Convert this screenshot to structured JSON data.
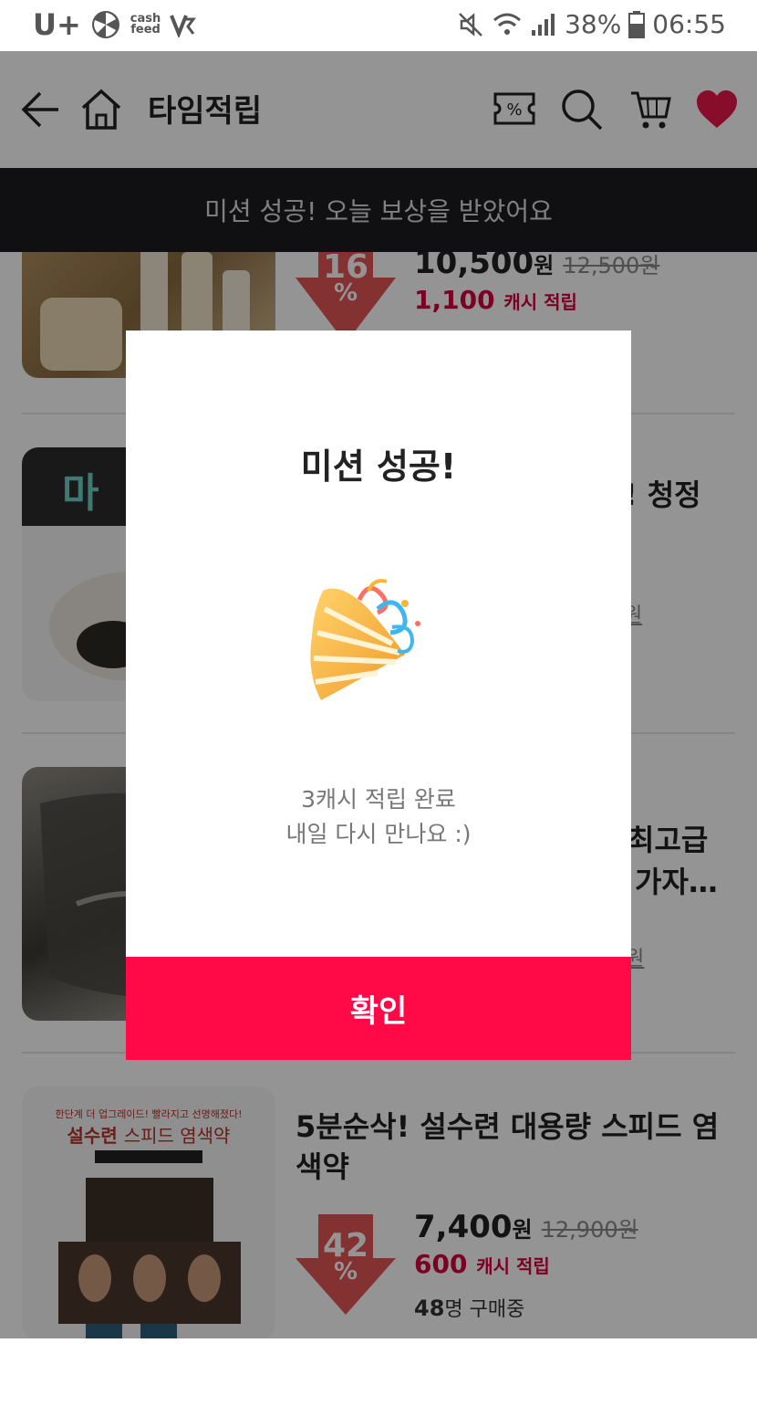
{
  "status_bar": {
    "carrier": "U+",
    "app_label_top": "cash",
    "app_label_bottom": "feed",
    "battery": "38%",
    "time": "06:55"
  },
  "app_bar": {
    "title": "타임적립",
    "icons": [
      "back-arrow-icon",
      "home-icon",
      "coupon-icon",
      "search-icon",
      "cart-icon",
      "heart-icon"
    ]
  },
  "banner": {
    "text": "미션 성공! 오늘 보상을 받았어요"
  },
  "products": [
    {
      "discount": "16",
      "price": "10,500",
      "price_unit": "원",
      "original_price": "12,500원",
      "cash": "1,100",
      "cash_label": "캐시 적립"
    },
    {
      "thumb_label": "마",
      "title_fragment": "! 청정",
      "original_fragment": "원"
    },
    {
      "title_fragment_1": "최고급",
      "title_fragment_2": "가자…",
      "original_fragment": "원"
    },
    {
      "title": "5분순삭! 설수련 대용량 스피드 염색약",
      "thumb_text_1": "한단계 더 업그레이드! 빨라지고 선명해졌다!",
      "thumb_text_2": "설수련",
      "thumb_text_3": "스피드 염색약",
      "discount": "42",
      "price": "7,400",
      "price_unit": "원",
      "original_price": "12,900원",
      "cash": "600",
      "cash_label": "캐시 적립",
      "buyers_count": "48",
      "buyers_label": "명 구매중"
    }
  ],
  "modal": {
    "title": "미션 성공!",
    "message_line1": "3캐시 적립 완료",
    "message_line2": "내일 다시 만나요 :)",
    "confirm_label": "확인"
  },
  "colors": {
    "accent": "#ff0a47",
    "cash_red": "#d6003f",
    "banner_bg": "#1c1d20",
    "discount_red": "#e25555"
  }
}
